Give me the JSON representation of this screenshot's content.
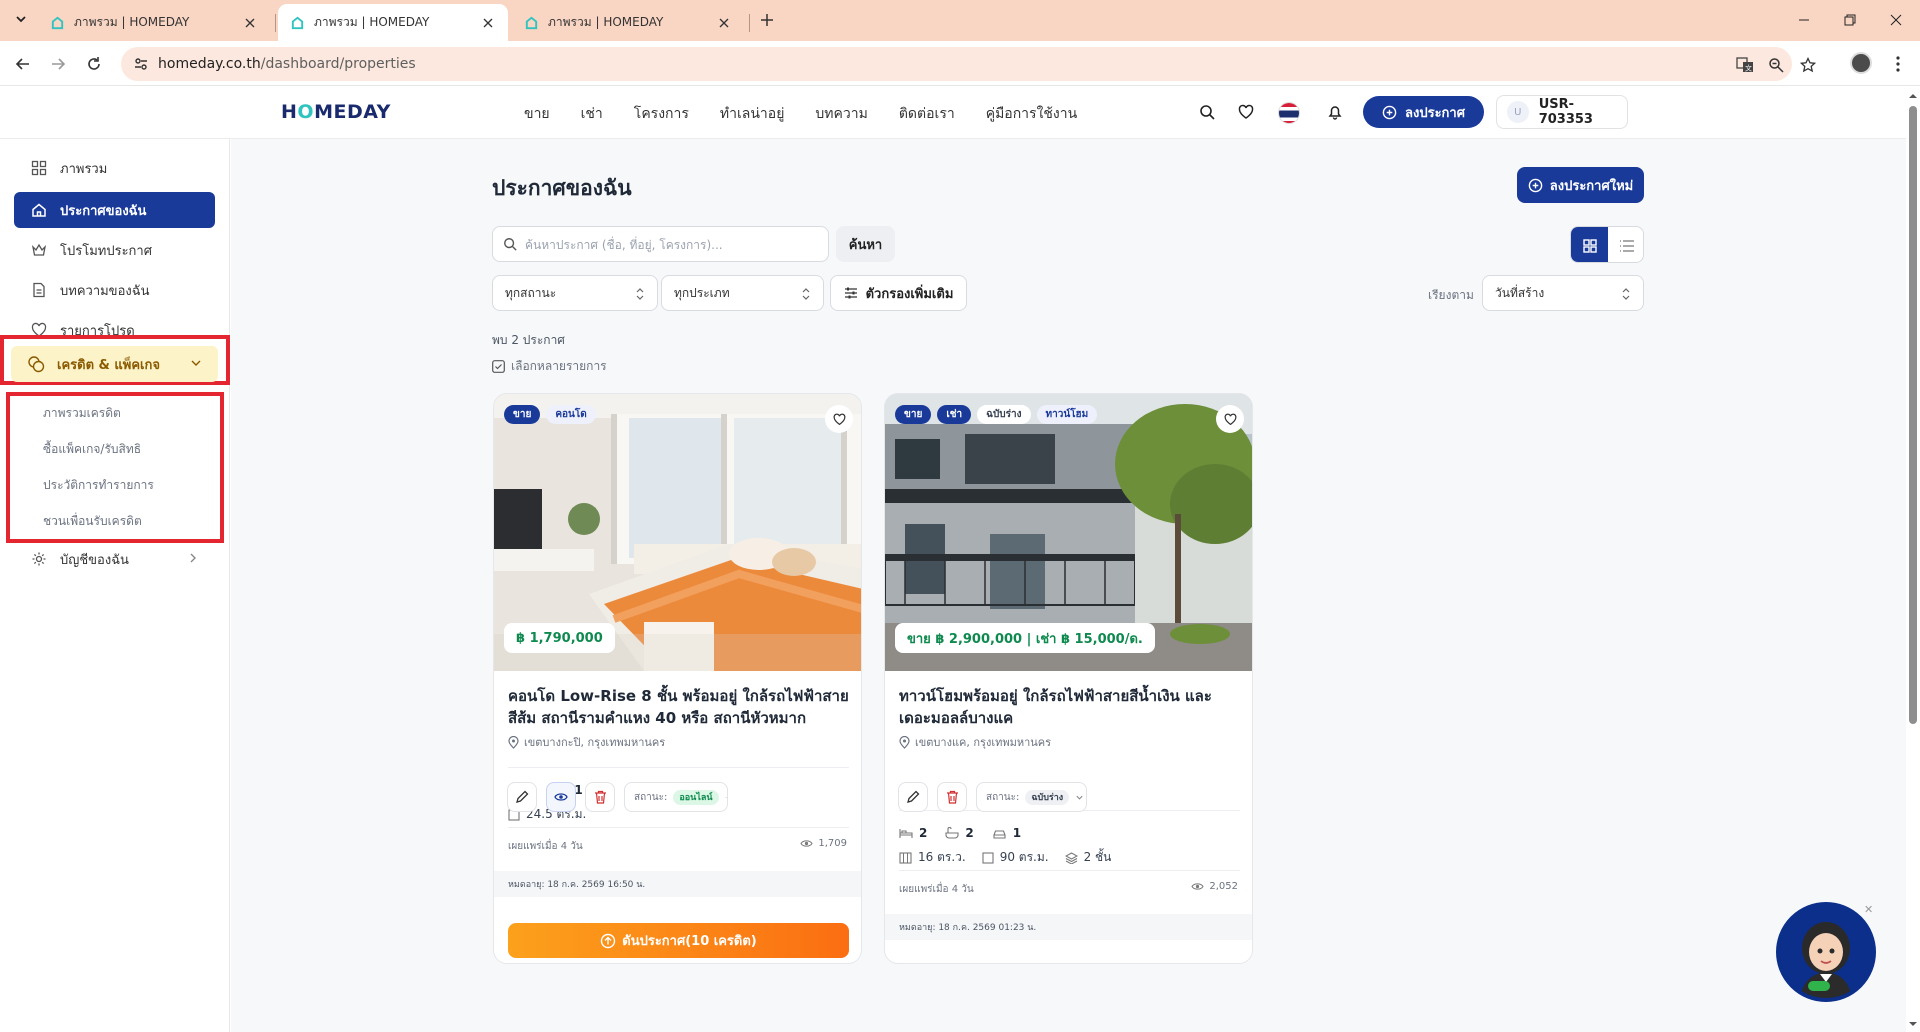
{
  "browser": {
    "tabs": [
      {
        "title": "ภาพรวม | HOMEDAY",
        "active": false
      },
      {
        "title": "ภาพรวม | HOMEDAY",
        "active": true
      },
      {
        "title": "ภาพรวม | HOMEDAY",
        "active": false
      }
    ],
    "url_host": "homeday.co.th",
    "url_path": "/dashboard/properties"
  },
  "header": {
    "logo_pre": "H",
    "logo_o": "O",
    "logo_post": "MEDAY",
    "nav": [
      "ขาย",
      "เช่า",
      "โครงการ",
      "ทำเลน่าอยู่",
      "บทความ",
      "ติดต่อเรา",
      "คู่มือการใช้งาน"
    ],
    "post_button": "ลงประกาศ",
    "user_initial": "U",
    "user_id": "USR-703353"
  },
  "sidebar": {
    "items": [
      {
        "label": "ภาพรวม",
        "icon": "grid-icon"
      },
      {
        "label": "ประกาศของฉัน",
        "icon": "home-icon"
      },
      {
        "label": "โปรโมทประกาศ",
        "icon": "crown-icon"
      },
      {
        "label": "บทความของฉัน",
        "icon": "document-icon"
      },
      {
        "label": "รายการโปรด",
        "icon": "heart-icon"
      }
    ],
    "credit": {
      "label": "เครดิต & แพ็คเกจ",
      "icon": "coins-icon"
    },
    "credit_sub": [
      "ภาพรวมเครดิต",
      "ซื้อแพ็คเกจ/รับสิทธิ",
      "ประวัติการทำรายการ",
      "ชวนเพื่อนรับเครดิต"
    ],
    "account": {
      "label": "บัญชีของฉัน",
      "icon": "gear-icon"
    }
  },
  "main": {
    "title": "ประกาศของฉัน",
    "new_post": "ลงประกาศใหม่",
    "search_placeholder": "ค้นหาประกาศ (ชื่อ, ที่อยู่, โครงการ)...",
    "search_button": "ค้นหา",
    "status_filter": "ทุกสถานะ",
    "type_filter": "ทุกประเภท",
    "more_filters": "ตัวกรองเพิ่มเติม",
    "sort_label": "เรียงตาม",
    "sort_value": "วันที่สร้าง",
    "found": "พบ 2 ประกาศ",
    "multi_select": "เลือกหลายรายการ"
  },
  "cards": [
    {
      "badges": [
        "ขาย",
        "คอนโด"
      ],
      "price": "฿ 1,790,000",
      "title": "คอนโด Low-Rise 8 ชั้น พร้อมอยู่ ใกล้รถไฟฟ้าสายสีส้ม สถานีรามคำแหง 40 หรือ สถานีหัวหมาก",
      "location": "เขตบางกะปิ, กรุงเทพมหานคร",
      "bed": "1",
      "bath": "1",
      "area": "24.5 ตร.ม.",
      "published": "เผยแพร่เมื่อ 4 วัน",
      "views": "1,709",
      "expires": "หมดอายุ: 18 ก.ค. 2569 16:50 น.",
      "boost": "ดันประกาศ(10 เครดิต)",
      "status_label": "สถานะ:",
      "status": "ออนไลน์"
    },
    {
      "badges": [
        "ขาย",
        "เช่า",
        "ฉบับร่าง",
        "ทาวน์โฮม"
      ],
      "price": "ขาย ฿ 2,900,000 | เช่า ฿ 15,000/ด.",
      "title": "ทาวน์โฮมพร้อมอยู่ ใกล้รถไฟฟ้าสายสีน้ำเงิน และเดอะมอลล์บางแค",
      "location": "เขตบางแค, กรุงเทพมหานคร",
      "bed": "2",
      "bath": "2",
      "parking": "1",
      "land": "16 ตร.ว.",
      "area": "90 ตร.ม.",
      "floors": "2 ชั้น",
      "published": "เผยแพร่เมื่อ 4 วัน",
      "views": "2,052",
      "expires": "หมดอายุ: 18 ก.ค. 2569 01:23 น.",
      "status_label": "สถานะ:",
      "status": "ฉบับร่าง"
    }
  ],
  "colors": {
    "navy": "#1a3a9a",
    "accent_teal": "#2fc4c0",
    "price_green": "#0f8a4f",
    "boost_orange": "#fb8a14",
    "highlight_red": "#e3262f"
  }
}
